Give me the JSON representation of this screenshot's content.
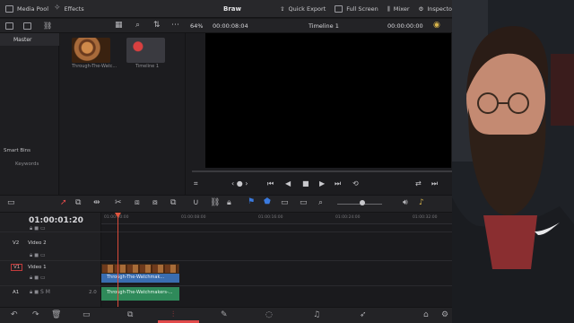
{
  "top": {
    "media_pool": "Media Pool",
    "effects": "Effects",
    "project_title": "Braw",
    "quick_export": "Quick Export",
    "full_screen": "Full Screen",
    "mixer": "Mixer",
    "inspector": "Inspecto"
  },
  "bins": {
    "master": "Master",
    "smart_bins": "Smart Bins",
    "keywords": "Keywords"
  },
  "pool": {
    "clips": [
      {
        "label": "Through-The-Watc..."
      },
      {
        "label": "Timeline 1"
      }
    ]
  },
  "viewer": {
    "zoom": "64%",
    "source_tc": "00:00:08:04",
    "timeline_name": "Timeline 1",
    "record_tc": "00:00:00:00"
  },
  "timeline": {
    "timecode": "01:00:01:20",
    "ruler": [
      "01:00:00:00",
      "01:00:08:00",
      "01:00:16:00",
      "01:00:24:00",
      "01:00:32:00"
    ],
    "tracks": {
      "v2": "V2",
      "video2": "Video 2",
      "v1": "V1",
      "video1": "Video 1",
      "a1": "A1",
      "a1_level": "2.0"
    },
    "video_clip": "Through-The-Watchmak...",
    "audio_clip": "Through-The-Watchmakers-..."
  },
  "colors": {
    "accent": "#e04a4a",
    "video_clip": "#3a6db0",
    "audio_clip": "#2f8a5a",
    "playhead": "#d94a3a"
  }
}
